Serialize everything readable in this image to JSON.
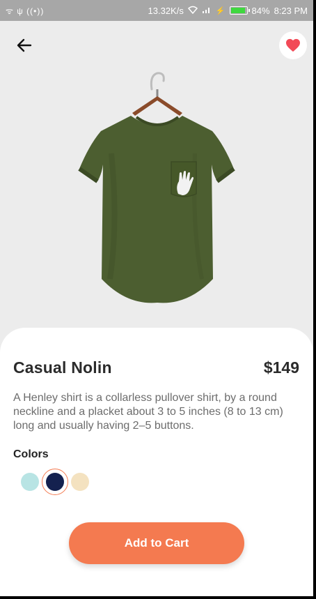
{
  "status_bar": {
    "left_icons": "ᯤ ψ ((•))",
    "network_speed": "13.32K/s",
    "battery_percent": "84%",
    "time": "8:23 PM"
  },
  "header": {
    "back_icon": "arrow-left",
    "favorite_icon": "heart",
    "favorite_color": "#f24a57"
  },
  "product": {
    "name": "Casual Nolin",
    "price": "$149",
    "description": "A Henley shirt is a collarless pullover shirt, by a round neckline and a placket about 3 to 5 inches (8 to 13 cm) long and usually having 2–5 buttons.",
    "image_color": "#4c5e30"
  },
  "colors": {
    "heading": "Colors",
    "options": [
      "#b8e4e4",
      "#14214f",
      "#f4e2c0"
    ],
    "selected_index": 1
  },
  "actions": {
    "add_to_cart": "Add to Cart",
    "accent": "#f47a50"
  }
}
